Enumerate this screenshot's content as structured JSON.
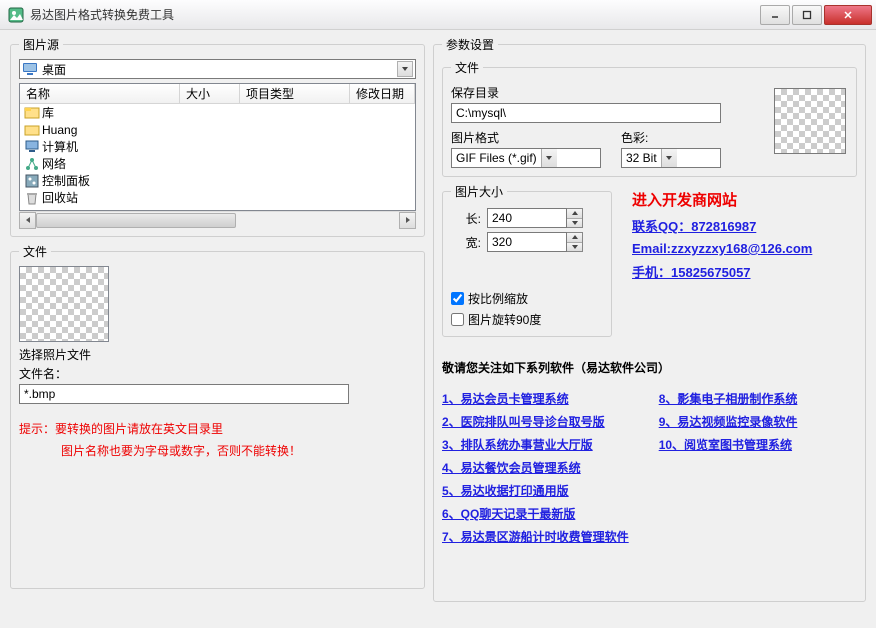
{
  "window": {
    "title": "易达图片格式转换免费工具"
  },
  "left": {
    "source_group": "图片源",
    "current_folder": "桌面",
    "columns": {
      "name": "名称",
      "size": "大小",
      "type": "项目类型",
      "date": "修改日期"
    },
    "items": [
      "库",
      "Huang",
      "计算机",
      "网络",
      "控制面板",
      "回收站"
    ],
    "file_group": "文件",
    "select_label": "选择照片文件",
    "filename_label": "文件名：",
    "filter_value": "*.bmp",
    "hint_line1": "提示：要转换的图片请放在英文目录里",
    "hint_line2": "图片名称也要为字母或数字，否则不能转换！"
  },
  "right": {
    "param_group": "参数设置",
    "file_group": "文件",
    "save_dir_label": "保存目录",
    "save_dir_value": "C:\\mysql\\",
    "format_label": "图片格式",
    "format_value": "GIF Files (*.gif)",
    "color_label": "色彩:",
    "color_value": "32 Bit",
    "size_group": "图片大小",
    "width_label": "长:",
    "width_value": "240",
    "height_label": "宽:",
    "height_value": "320",
    "keep_ratio": "按比例缩放",
    "rotate90": "图片旋转90度",
    "vendor": {
      "title": "进入开发商网站",
      "qq": "联系QQ：872816987",
      "email": "Email:zzxyzzxy168@126.com",
      "phone": "手机：15825675057"
    },
    "software_title": "敬请您关注如下系列软件（易达软件公司）",
    "software_left": [
      "1、易达会员卡管理系统",
      "2、医院排队叫号导诊台取号版",
      "3、排队系统办事营业大厅版",
      "4、易达餐饮会员管理系统",
      "5、易达收据打印通用版",
      "6、QQ聊天记录干最新版",
      "7、易达景区游船计时收费管理软件"
    ],
    "software_right": [
      "8、影集电子相册制作系统",
      "9、易达视频监控录像软件",
      "10、阅览室图书管理系统"
    ]
  }
}
